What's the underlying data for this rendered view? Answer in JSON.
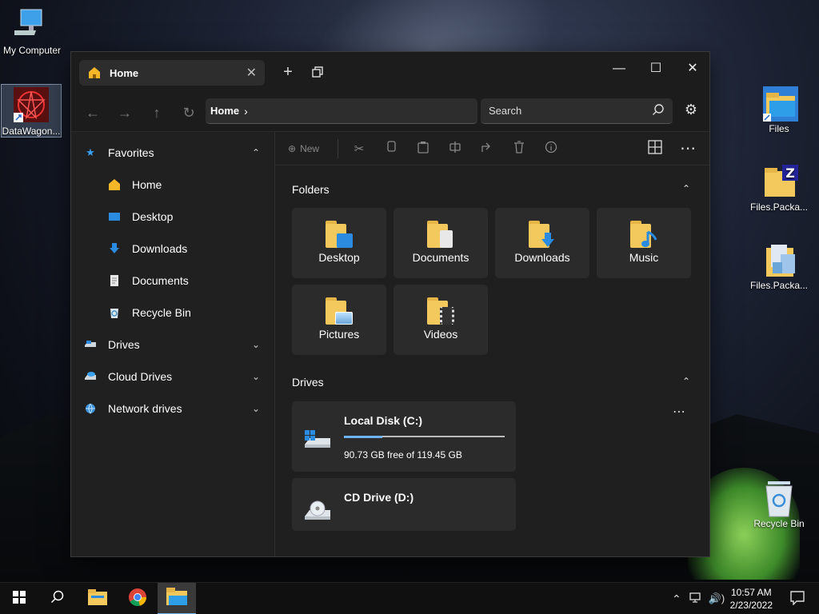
{
  "desktop": {
    "icons": [
      {
        "label": "My Computer"
      },
      {
        "label": "DataWagon..."
      },
      {
        "label": "Files"
      },
      {
        "label": "Files.Packa..."
      },
      {
        "label": "Files.Packa..."
      },
      {
        "label": "Recycle Bin"
      }
    ]
  },
  "window": {
    "tab": {
      "label": "Home",
      "close": "✕"
    },
    "new_tab": "+",
    "controls": {
      "minimize": "—",
      "maximize": "☐",
      "close": "✕"
    },
    "nav": {
      "back": "←",
      "forward": "→",
      "up": "↑",
      "refresh": "↻"
    },
    "address": {
      "path": "Home",
      "chevron": "›"
    },
    "search": {
      "placeholder": "Search",
      "icon": "⌕"
    },
    "settings_icon": "⚙"
  },
  "sidebar": {
    "items": [
      {
        "label": "Favorites",
        "level": "top",
        "chevron": "⌃"
      },
      {
        "label": "Home",
        "level": "sub"
      },
      {
        "label": "Desktop",
        "level": "sub"
      },
      {
        "label": "Downloads",
        "level": "sub"
      },
      {
        "label": "Documents",
        "level": "sub"
      },
      {
        "label": "Recycle Bin",
        "level": "sub"
      },
      {
        "label": "Drives",
        "level": "top",
        "chevron": "⌄"
      },
      {
        "label": "Cloud Drives",
        "level": "top",
        "chevron": "⌄"
      },
      {
        "label": "Network drives",
        "level": "top",
        "chevron": "⌄"
      }
    ]
  },
  "toolbar": {
    "new_label": "New",
    "more": "⋯"
  },
  "folders": {
    "title": "Folders",
    "toggle": "⌃",
    "items": [
      {
        "label": "Desktop",
        "overlay": "#2a8be0"
      },
      {
        "label": "Documents",
        "overlay": "#e8e8e8"
      },
      {
        "label": "Downloads",
        "overlay": "#2a8be0"
      },
      {
        "label": "Music",
        "overlay": "#2a8be0"
      },
      {
        "label": "Pictures",
        "overlay": "#6aa6d8"
      },
      {
        "label": "Videos",
        "overlay": "#333333"
      }
    ]
  },
  "drives": {
    "title": "Drives",
    "toggle": "⌃",
    "more": "⋯",
    "items": [
      {
        "name": "Local Disk (C:)",
        "free": "90.73 GB free of 119.45 GB",
        "used_fraction": 0.24
      },
      {
        "name": "CD Drive (D:)"
      }
    ]
  },
  "taskbar": {
    "time": "10:57 AM",
    "date": "2/23/2022",
    "tray": {
      "chevron": "⌃",
      "volume": "🔊)"
    }
  },
  "colors": {
    "accent": "#6fb3f2",
    "folder": "#f3c95e"
  }
}
